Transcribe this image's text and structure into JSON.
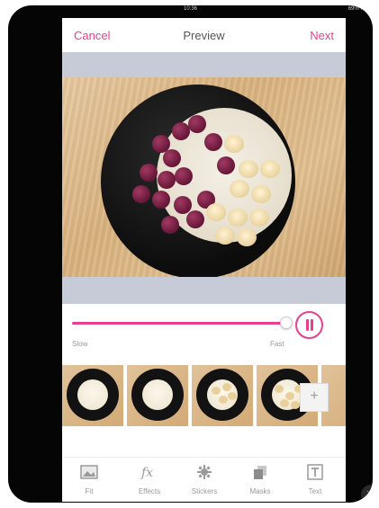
{
  "status": {
    "time": "10:36",
    "battery": "69% ■"
  },
  "nav": {
    "cancel": "Cancel",
    "title": "Preview",
    "next": "Next"
  },
  "speed": {
    "slow_label": "Slow",
    "fast_label": "Fast",
    "value": 1.0
  },
  "filmstrip": {
    "add_label": "+"
  },
  "toolbar": {
    "items": [
      {
        "label": "Fit",
        "icon": "fit-icon"
      },
      {
        "label": "Effects",
        "icon": "fx-icon"
      },
      {
        "label": "Stickers",
        "icon": "sticker-icon"
      },
      {
        "label": "Masks",
        "icon": "masks-icon"
      },
      {
        "label": "Text",
        "icon": "text-icon"
      }
    ]
  },
  "colors": {
    "accent": "#ea3f8c",
    "letterbox": "#c7cbd8"
  }
}
